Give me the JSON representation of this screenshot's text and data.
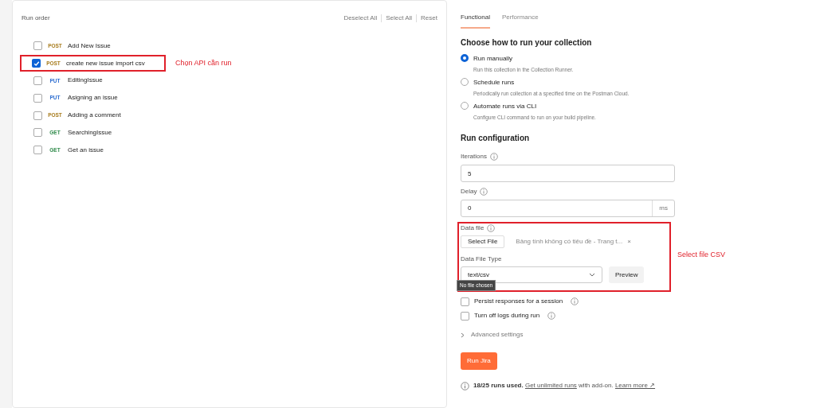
{
  "run_order": {
    "title": "Run order",
    "actions": [
      "Deselect All",
      "Select All",
      "Reset"
    ],
    "items": [
      {
        "method": "POST",
        "name": "Add New Issue",
        "checked": false
      },
      {
        "method": "POST",
        "name": "create new issue import csv",
        "checked": true,
        "annotation": "Chọn API cần run"
      },
      {
        "method": "PUT",
        "name": "EditingIssue",
        "checked": false
      },
      {
        "method": "PUT",
        "name": "Asigning an issue",
        "checked": false
      },
      {
        "method": "POST",
        "name": "Adding a comment",
        "checked": false
      },
      {
        "method": "GET",
        "name": "SearchingIssue",
        "checked": false
      },
      {
        "method": "GET",
        "name": "Get an issue",
        "checked": false
      }
    ]
  },
  "tabs": [
    {
      "label": "Functional",
      "selected": true
    },
    {
      "label": "Performance",
      "selected": false
    }
  ],
  "run_mode": {
    "title": "Choose how to run your collection",
    "options": [
      {
        "label": "Run manually",
        "description": "Run this collection in the Collection Runner.",
        "selected": true
      },
      {
        "label": "Schedule runs",
        "description": "Periodically run collection at a specified time on the Postman Cloud.",
        "selected": false
      },
      {
        "label": "Automate runs via CLI",
        "description": "Configure CLI command to run on your build pipeline.",
        "selected": false
      }
    ]
  },
  "config": {
    "title": "Run configuration",
    "iterations": {
      "label": "Iterations",
      "value": "5"
    },
    "delay": {
      "label": "Delay",
      "value": "0",
      "unit": "ms"
    },
    "data_file": {
      "label": "Data file",
      "button": "Select File",
      "file_name": "Bảng tính không có tiêu đề - Trang t...",
      "remove": "×",
      "tooltip": "No file chosen",
      "type_label": "Data File Type",
      "type_value": "text/csv",
      "preview": "Preview",
      "annotation": "Select file CSV"
    },
    "options": [
      {
        "label": "Persist responses for a session",
        "checked": false
      },
      {
        "label": "Turn off logs during run",
        "checked": false
      }
    ],
    "advanced": {
      "label": "Advanced settings",
      "expanded": false
    },
    "run_button": "Run Jira"
  },
  "footer": {
    "usage": "18/25 runs used.",
    "link": "Get unlimited runs",
    "middle": "with add-on.",
    "learn_more": "Learn more ↗"
  }
}
